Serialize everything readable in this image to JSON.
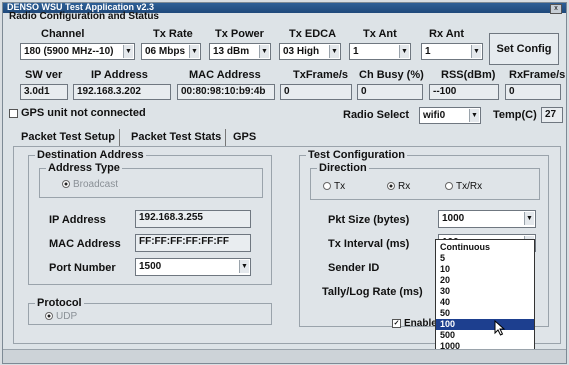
{
  "window": {
    "title": "DENSO WSU Test Application v2.3",
    "close_label": "x"
  },
  "section_title": "Radio Configuration and Status",
  "radio": {
    "headers": [
      "Channel",
      "Tx Rate",
      "Tx Power",
      "Tx EDCA",
      "Tx Ant",
      "Rx Ant"
    ],
    "values": [
      "180 (5900 MHz--10)",
      "06 Mbps",
      "13 dBm",
      "03 High",
      "1",
      "1"
    ],
    "set_config_label": "Set Config"
  },
  "status": {
    "headers": [
      "SW ver",
      "IP Address",
      "MAC Address",
      "TxFrame/s",
      "Ch Busy (%)",
      "RSS(dBm)",
      "RxFrame/s"
    ],
    "values": [
      "3.0d1",
      "192.168.3.202",
      "00:80:98:10:b9:4b",
      "0",
      "0",
      "--100",
      "0"
    ]
  },
  "gps": {
    "label": "GPS unit not connected"
  },
  "radio_select": {
    "label": "Radio Select",
    "value": "wifi0"
  },
  "temp": {
    "label": "Temp(C)",
    "value": "27"
  },
  "tabs": [
    "Packet Test Setup",
    "Packet Test Stats",
    "GPS"
  ],
  "destination": {
    "title": "Destination Address",
    "address_type_label": "Address Type",
    "broadcast_label": "Broadcast",
    "ip_label": "IP Address",
    "ip_value": "192.168.3.255",
    "mac_label": "MAC Address",
    "mac_value": "FF:FF:FF:FF:FF:FF",
    "port_label": "Port Number",
    "port_value": "1500"
  },
  "protocol": {
    "title": "Protocol",
    "udp_label": "UDP"
  },
  "test_config": {
    "title": "Test Configuration",
    "direction_label": "Direction",
    "tx_label": "Tx",
    "rx_label": "Rx",
    "txrx_label": "Tx/Rx",
    "pkt_size_label": "Pkt Size (bytes)",
    "pkt_size_value": "1000",
    "tx_interval_label": "Tx Interval (ms)",
    "tx_interval_value": "100",
    "sender_id_label": "Sender ID",
    "tally_label": "Tally/Log Rate (ms)",
    "enable_label": "Enable L"
  },
  "interval_options": [
    "Continuous",
    "5",
    "10",
    "20",
    "30",
    "40",
    "50",
    "100",
    "500",
    "1000"
  ],
  "interval_selected": "100"
}
